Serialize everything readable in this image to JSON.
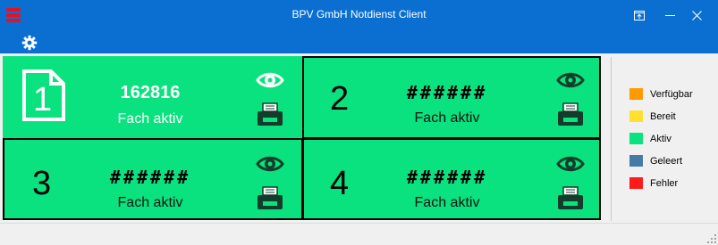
{
  "window": {
    "title": "BPV GmbH Notdienst Client",
    "app_icon": "stacked-bars-icon",
    "controls": [
      "restore-to-tray-icon",
      "minimize-icon",
      "close-icon"
    ]
  },
  "toolbar": {
    "settings_icon": "gear-icon"
  },
  "panels": [
    {
      "number": "1",
      "code": "162816",
      "status": "Fach aktiv",
      "style": "document-icon"
    },
    {
      "number": "2",
      "code": "######",
      "status": "Fach aktiv"
    },
    {
      "number": "3",
      "code": "######",
      "status": "Fach aktiv"
    },
    {
      "number": "4",
      "code": "######",
      "status": "Fach aktiv"
    }
  ],
  "legend": [
    {
      "label": "Verfügbar",
      "color": "#ff9a00"
    },
    {
      "label": "Bereit",
      "color": "#ffe02e"
    },
    {
      "label": "Aktiv",
      "color": "#09e27e"
    },
    {
      "label": "Geleert",
      "color": "#467ba6"
    },
    {
      "label": "Fehler",
      "color": "#ff1a1a"
    }
  ],
  "colors": {
    "titlebar": "#0a6fd1",
    "panel_active": "#09e27e"
  }
}
